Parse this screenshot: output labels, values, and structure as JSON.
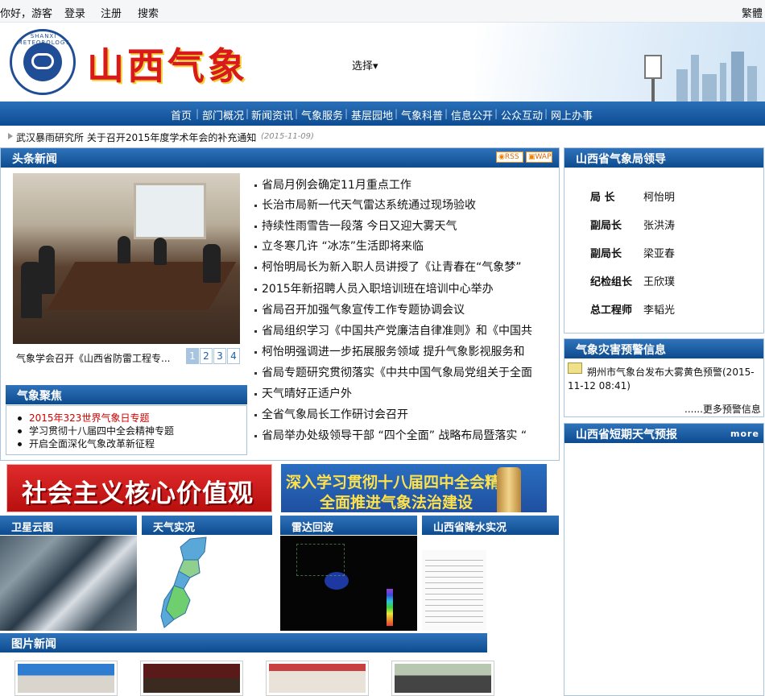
{
  "topbar": {
    "greeting": "你好，游客",
    "login": "登录",
    "register": "注册",
    "search": "搜索",
    "traditional": "繁體"
  },
  "header": {
    "logo_text": "山西气象",
    "logo_ring": "SHANXI METEOROLOGY",
    "select_label": "选择"
  },
  "nav": {
    "items": [
      "首页",
      "部门概况",
      "新闻资讯",
      "气象服务",
      "基层园地",
      "气象科普",
      "信息公开",
      "公众互动",
      "网上办事"
    ]
  },
  "notice": {
    "text": "武汉暴雨研究所 关于召开2015年度学术年会的补充通知",
    "date": "(2015-11-09)"
  },
  "headlines": {
    "title": "头条新闻",
    "rss": "RSS",
    "wap": "WAP",
    "caption": "气象学会召开《山西省防雷工程专...",
    "pages": [
      "1",
      "2",
      "3",
      "4"
    ],
    "items": [
      "省局月例会确定11月重点工作",
      "长治市局新一代天气雷达系统通过现场验收",
      "持续性雨雪告一段落  今日又迎大雾天气",
      "立冬寒几许  “冰冻”生活即将来临",
      "柯怡明局长为新入职人员讲授了《让青春在“气象梦”",
      "2015年新招聘人员入职培训班在培训中心举办",
      "省局召开加强气象宣传工作专题协调会议",
      "省局组织学习《中国共产党廉洁自律准则》和《中国共",
      "柯怡明强调进一步拓展服务领域  提升气象影视服务和",
      "省局专题研究贯彻落实《中共中国气象局党组关于全面",
      "天气晴好正适户外",
      "全省气象局长工作研讨会召开",
      "省局举办处级领导干部 “四个全面” 战略布局暨落实 “"
    ]
  },
  "focus": {
    "title": "气象聚焦",
    "items": [
      "2015年323世界气象日专题",
      "学习贯彻十八届四中全会精神专题",
      "开启全面深化气象改革新征程"
    ]
  },
  "banners": {
    "left": "社会主义核心价值观",
    "right_line1": "深入学习贯彻十八届四中全会精神",
    "right_line2": "全面推进气象法治建设"
  },
  "tiles": {
    "satellite": "卫星云图",
    "weather": "天气实况",
    "radar": "雷达回波",
    "rain": "山西省降水实况"
  },
  "pictures": {
    "title": "图片新闻"
  },
  "leaders": {
    "title": "山西省气象局领导",
    "rows": [
      {
        "role": "局  长",
        "name": "柯怡明"
      },
      {
        "role": "副局长",
        "name": "张洪涛"
      },
      {
        "role": "副局长",
        "name": "梁亚春"
      },
      {
        "role": "纪检组长",
        "name": "王欣璞"
      },
      {
        "role": "总工程师",
        "name": "李韬光"
      }
    ]
  },
  "warning": {
    "title": "气象灾害预警信息",
    "text": "朔州市气象台发布大雾黄色预警(2015-11-12 08:41)",
    "more": "......更多预警信息"
  },
  "forecast": {
    "title": "山西省短期天气预报",
    "more": "more"
  },
  "colors": {
    "nav_blue": "#0d4c93",
    "logo_red": "#d91a1a",
    "focus_red": "#d40000"
  }
}
